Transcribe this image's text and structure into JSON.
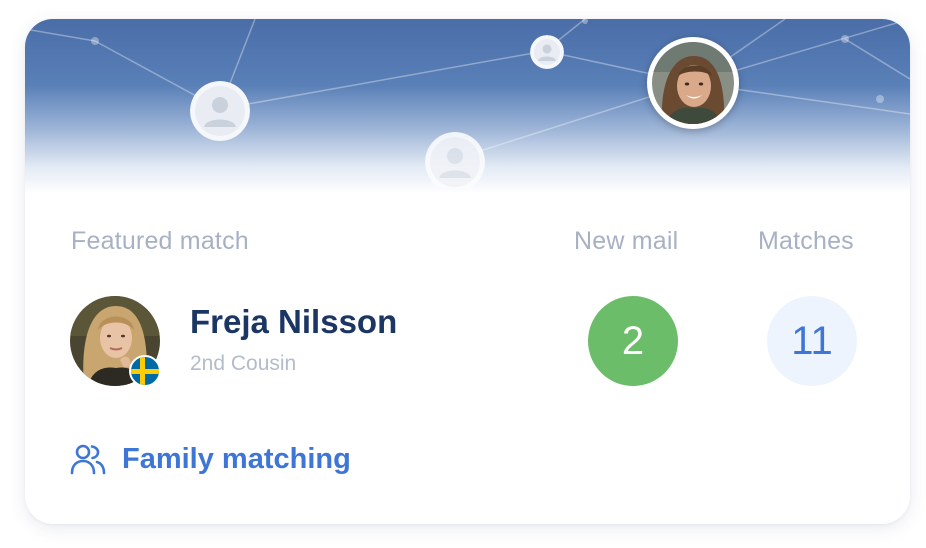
{
  "labels": {
    "featured": "Featured match",
    "new_mail": "New mail",
    "matches": "Matches"
  },
  "featured_match": {
    "name": "Freja Nilsson",
    "relationship": "2nd Cousin",
    "flag": "sweden-flag-icon"
  },
  "stats": {
    "new_mail": "2",
    "matches": "11"
  },
  "family_link": {
    "label": "Family matching",
    "icon": "people-icon"
  },
  "colors": {
    "accent": "#3d76d6",
    "mail_badge": "#6cbd6a",
    "matches_badge_bg": "#eef4fd",
    "name": "#1c3664",
    "muted": "#a7b1c3",
    "banner_top": "#4a6da8"
  }
}
